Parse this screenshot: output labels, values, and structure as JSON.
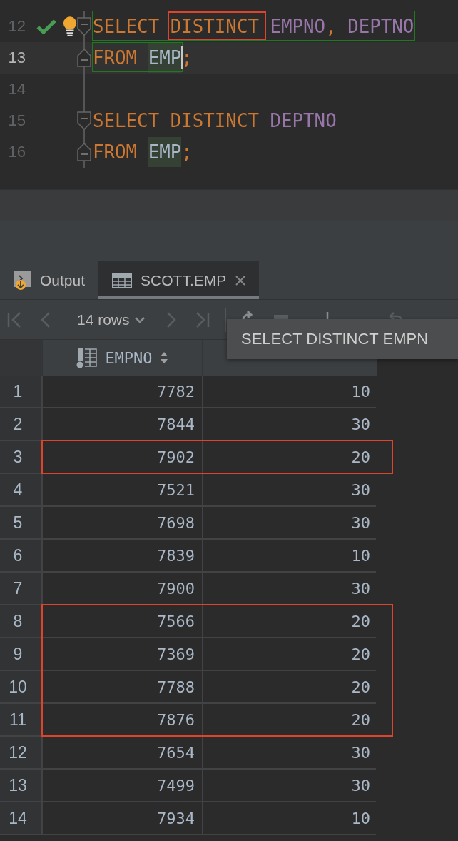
{
  "editor": {
    "lines": [
      {
        "number": "12",
        "current": false,
        "check": true,
        "bulb": true,
        "fold_start": true,
        "fold_end": false,
        "tokens": [
          {
            "text": "SELECT ",
            "kind": "keyword",
            "outlined": true
          },
          {
            "text": "DISTINCT",
            "kind": "keyword",
            "outlined": true,
            "marked": true
          },
          {
            "text": " EMPNO",
            "kind": "column",
            "outlined": true
          },
          {
            "text": ", ",
            "kind": "keyword",
            "outlined": true
          },
          {
            "text": "DEPTNO",
            "kind": "column",
            "outlined": true
          }
        ]
      },
      {
        "number": "13",
        "current": true,
        "check": false,
        "bulb": false,
        "fold_start": false,
        "fold_end": true,
        "tokens": [
          {
            "text": "FROM ",
            "kind": "keyword",
            "outlined": true
          },
          {
            "text": "EMP",
            "kind": "table",
            "outlined": true,
            "caret": true
          },
          {
            "text": ";",
            "kind": "keyword",
            "outlined": false
          }
        ]
      },
      {
        "number": "14",
        "current": false,
        "check": false,
        "bulb": false,
        "fold_start": false,
        "fold_end": false
      },
      {
        "number": "15",
        "current": false,
        "check": false,
        "bulb": false,
        "fold_start": true,
        "fold_end": false,
        "tokens": [
          {
            "text": "SELECT DISTINCT ",
            "kind": "keyword",
            "outlined": false
          },
          {
            "text": "DEPTNO",
            "kind": "column",
            "outlined": false
          }
        ]
      },
      {
        "number": "16",
        "current": false,
        "check": false,
        "bulb": false,
        "fold_start": false,
        "fold_end": true,
        "tokens": [
          {
            "text": "FROM ",
            "kind": "keyword",
            "outlined": false
          },
          {
            "text": "EMP",
            "kind": "table",
            "outlined": false
          },
          {
            "text": ";",
            "kind": "keyword",
            "outlined": false
          }
        ]
      }
    ]
  },
  "tabs": [
    {
      "label": "Output",
      "kind": "output",
      "selected": false,
      "closable": false
    },
    {
      "label": "SCOTT.EMP",
      "kind": "table",
      "selected": true,
      "closable": true
    }
  ],
  "toolbar": {
    "row_count": "14 rows"
  },
  "tooltip": "SELECT DISTINCT EMPN",
  "table": {
    "columns": [
      "EMPNO"
    ],
    "rows": [
      {
        "number": "1",
        "cells": [
          "7782",
          "10"
        ],
        "marked": false
      },
      {
        "number": "2",
        "cells": [
          "7844",
          "30"
        ],
        "marked": false
      },
      {
        "number": "3",
        "cells": [
          "7902",
          "20"
        ],
        "marked": true
      },
      {
        "number": "4",
        "cells": [
          "7521",
          "30"
        ],
        "marked": false
      },
      {
        "number": "5",
        "cells": [
          "7698",
          "30"
        ],
        "marked": false
      },
      {
        "number": "6",
        "cells": [
          "7839",
          "10"
        ],
        "marked": false
      },
      {
        "number": "7",
        "cells": [
          "7900",
          "30"
        ],
        "marked": false
      },
      {
        "number": "8",
        "cells": [
          "7566",
          "20"
        ],
        "marked": true
      },
      {
        "number": "9",
        "cells": [
          "7369",
          "20"
        ],
        "marked": true
      },
      {
        "number": "10",
        "cells": [
          "7788",
          "20"
        ],
        "marked": true
      },
      {
        "number": "11",
        "cells": [
          "7876",
          "20"
        ],
        "marked": true
      },
      {
        "number": "12",
        "cells": [
          "7654",
          "30"
        ],
        "marked": false
      },
      {
        "number": "13",
        "cells": [
          "7499",
          "30"
        ],
        "marked": false
      },
      {
        "number": "14",
        "cells": [
          "7934",
          "10"
        ],
        "marked": false
      }
    ]
  }
}
